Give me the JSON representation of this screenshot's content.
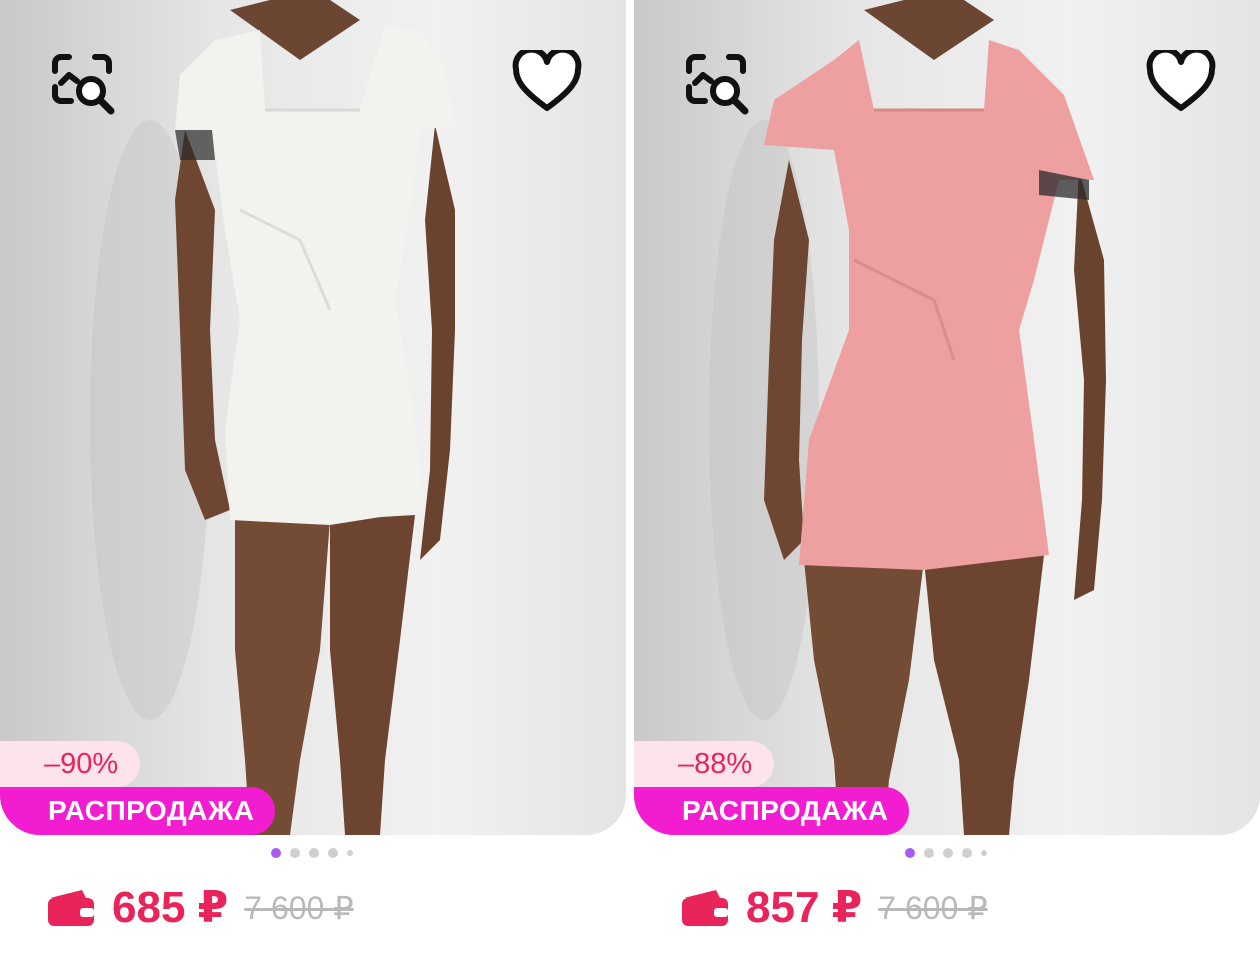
{
  "colors": {
    "accent": "#e8245a",
    "sale_badge": "#f21dd1",
    "discount_badge_bg": "#fde3ec",
    "dot_active": "#a65cf2",
    "dot_inactive": "#cfcfcf",
    "old_price": "#b9b9b9"
  },
  "products": [
    {
      "dress_color": "#f2f2ef",
      "discount": "–90%",
      "sale_label": "РАСПРОДАЖА",
      "price": "685 ₽",
      "old_price": "7 600 ₽",
      "icons": {
        "search": "image-search-icon",
        "favorite": "heart-icon",
        "price": "wallet-icon"
      },
      "carousel_active_index": 0
    },
    {
      "dress_color": "#ee9f9f",
      "discount": "–88%",
      "sale_label": "РАСПРОДАЖА",
      "price": "857 ₽",
      "old_price": "7 600 ₽",
      "icons": {
        "search": "image-search-icon",
        "favorite": "heart-icon",
        "price": "wallet-icon"
      },
      "carousel_active_index": 0
    }
  ]
}
